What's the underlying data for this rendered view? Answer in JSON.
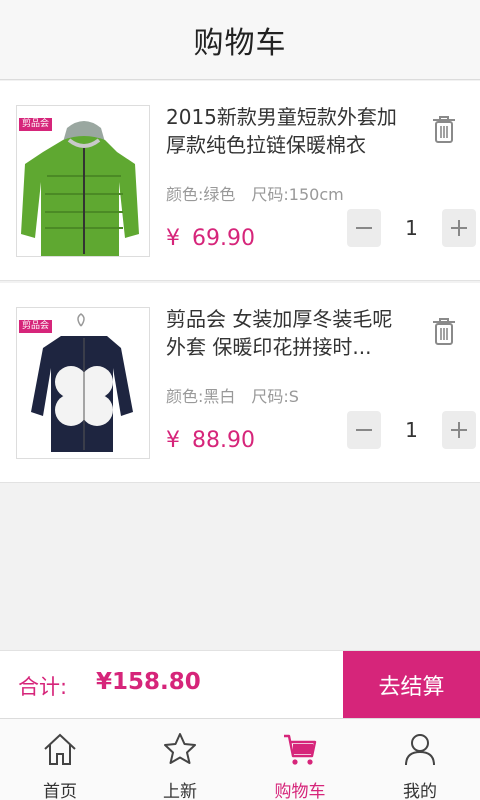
{
  "header": {
    "title": "购物车"
  },
  "cart": {
    "items": [
      {
        "brand_tag": "剪品会",
        "name": "2015新款男童短款外套加厚款纯色拉链保暖棉衣",
        "color_label": "颜色:绿色",
        "size_label": "尺码:150cm",
        "currency": "¥",
        "price": "69.90",
        "quantity": "1",
        "icon": "delete-icon"
      },
      {
        "brand_tag": "剪品会",
        "name": "剪品会 女装加厚冬装毛呢外套 保暖印花拼接时...",
        "color_label": "颜色:黑白",
        "size_label": "尺码:S",
        "currency": "¥",
        "price": "88.90",
        "quantity": "1",
        "icon": "delete-icon"
      }
    ]
  },
  "footer": {
    "total_label": "合计:",
    "total_value": "¥158.80",
    "checkout_label": "去结算"
  },
  "tabs": [
    {
      "label": "首页",
      "icon": "home-icon"
    },
    {
      "label": "上新",
      "icon": "star-icon"
    },
    {
      "label": "购物车",
      "icon": "cart-icon",
      "active": true
    },
    {
      "label": "我的",
      "icon": "user-icon"
    }
  ],
  "colors": {
    "accent": "#d6257a",
    "price": "#d6257a",
    "background": "#f2f2f2"
  }
}
